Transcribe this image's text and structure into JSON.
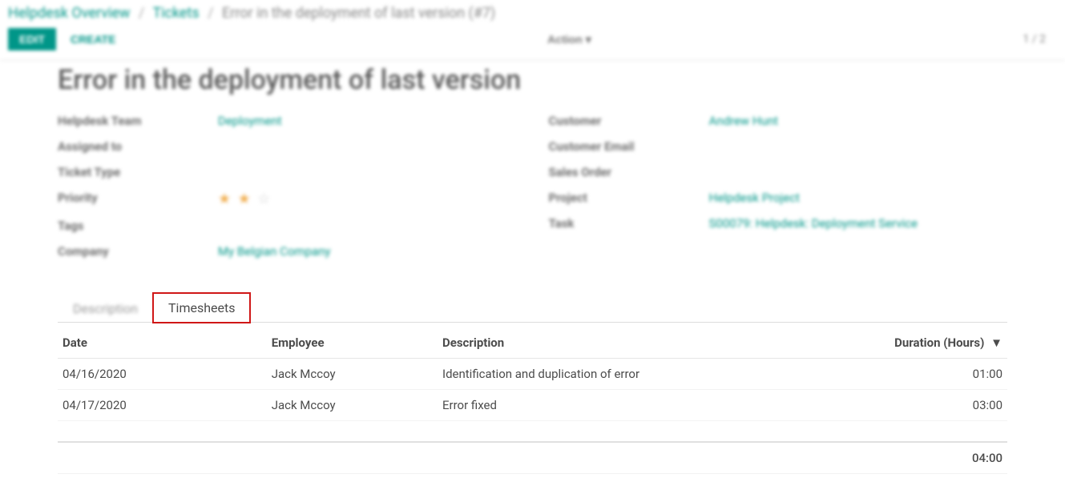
{
  "breadcrumb": {
    "root": "Helpdesk Overview",
    "mid": "Tickets",
    "current": "Error in the deployment of last version (#7)"
  },
  "toolbar": {
    "edit": "EDIT",
    "create": "CREATE",
    "action": "Action",
    "pager": "1 / 2"
  },
  "record": {
    "title": "Error in the deployment of last version"
  },
  "fields_left": {
    "team_label": "Helpdesk Team",
    "team_value": "Deployment",
    "assigned_label": "Assigned to",
    "assigned_value": "",
    "type_label": "Ticket Type",
    "type_value": "",
    "priority_label": "Priority",
    "tags_label": "Tags",
    "tags_value": "",
    "company_label": "Company",
    "company_value": "My Belgian Company"
  },
  "fields_right": {
    "customer_label": "Customer",
    "customer_value": "Andrew Hunt",
    "email_label": "Customer Email",
    "email_value": "",
    "so_label": "Sales Order",
    "so_value": "",
    "project_label": "Project",
    "project_value": "Helpdesk Project",
    "task_label": "Task",
    "task_value": "S00079: Helpdesk: Deployment Service"
  },
  "tabs": {
    "description": "Description",
    "timesheets": "Timesheets"
  },
  "table": {
    "headers": {
      "date": "Date",
      "employee": "Employee",
      "description": "Description",
      "duration": "Duration (Hours)"
    },
    "rows": [
      {
        "date": "04/16/2020",
        "employee": "Jack Mccoy",
        "description": "Identification and duplication of error",
        "duration": "01:00"
      },
      {
        "date": "04/17/2020",
        "employee": "Jack Mccoy",
        "description": "Error fixed",
        "duration": "03:00"
      }
    ],
    "total_duration": "04:00"
  }
}
